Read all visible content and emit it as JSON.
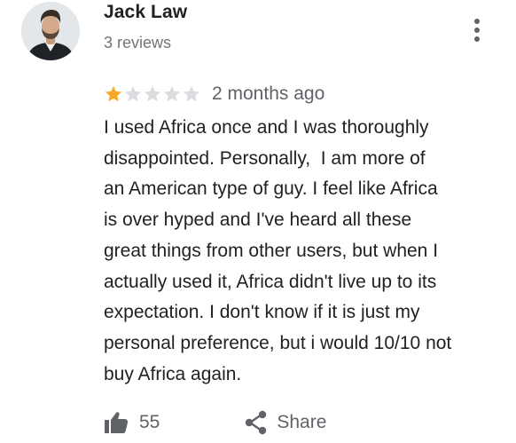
{
  "review": {
    "author_name": "Jack Law",
    "review_count": "3 reviews",
    "rating": 1,
    "rating_max": 5,
    "date": "2 months ago",
    "text_lines": [
      "I used Africa once and I was thoroughly",
      "disappointed. Personally,  I am more of",
      "an American type of guy. I feel like Africa",
      "is over hyped and I've heard all these",
      "great things from other users, but when I",
      "actually used it, Africa didn't live up to its",
      "expectation. I don't know if it is just my",
      "personal preference, but i would 10/10 not",
      "buy Africa again."
    ],
    "like_count": "55",
    "share_label": "Share"
  },
  "icons": {
    "avatar": "avatar-photo",
    "more": "more-vert-icon",
    "star": "star-icon",
    "like": "thumbs-up-icon",
    "share": "share-icon"
  },
  "colors": {
    "star_filled": "#f9a825",
    "star_empty": "#dadce0",
    "text_primary": "#202124",
    "text_secondary": "#5f6368"
  }
}
